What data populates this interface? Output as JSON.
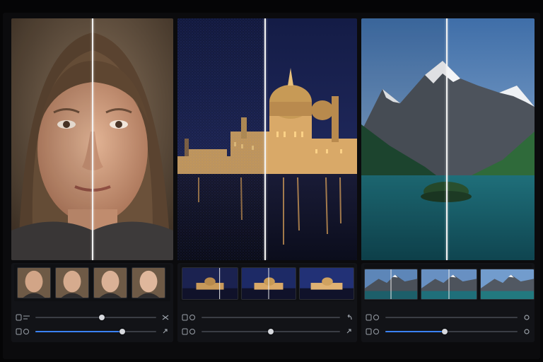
{
  "panels": [
    {
      "subject": "portrait",
      "divider_icon": "split-divider-icon"
    },
    {
      "subject": "night-city-waterfront",
      "divider_icon": "split-divider-icon"
    },
    {
      "subject": "mountain-lake",
      "divider_icon": "split-divider-icon"
    }
  ],
  "controls": [
    {
      "thumbnails": [
        "portrait-thumb",
        "portrait-thumb",
        "portrait-thumb",
        "portrait-thumb"
      ],
      "sliders": [
        {
          "icon": "sliders-icon",
          "value": 0.55,
          "filled": false,
          "end_icon": "shuffle-icon"
        },
        {
          "icon": "sliders-icon",
          "value": 0.72,
          "filled": true,
          "end_icon": "link-icon"
        }
      ]
    },
    {
      "thumbnails": [
        "city-thumb",
        "city-thumb",
        "city-thumb"
      ],
      "sliders": [
        {
          "icon": "sliders-icon",
          "value": 0.0,
          "filled": false,
          "end_icon": "undo-icon"
        },
        {
          "icon": "sliders-icon",
          "value": 0.5,
          "filled": false,
          "end_icon": "link-icon"
        }
      ]
    },
    {
      "thumbnails": [
        "mountain-thumb",
        "mountain-thumb",
        "mountain-thumb"
      ],
      "sliders": [
        {
          "icon": "sliders-icon",
          "value": 0.0,
          "filled": false,
          "end_icon": "circle-icon"
        },
        {
          "icon": "sliders-icon",
          "value": 0.45,
          "filled": true,
          "end_icon": "circle-icon"
        }
      ]
    }
  ],
  "colors": {
    "accent": "#3b82f6",
    "divider": "#f2f2f2",
    "panel_bg": "#121317"
  }
}
